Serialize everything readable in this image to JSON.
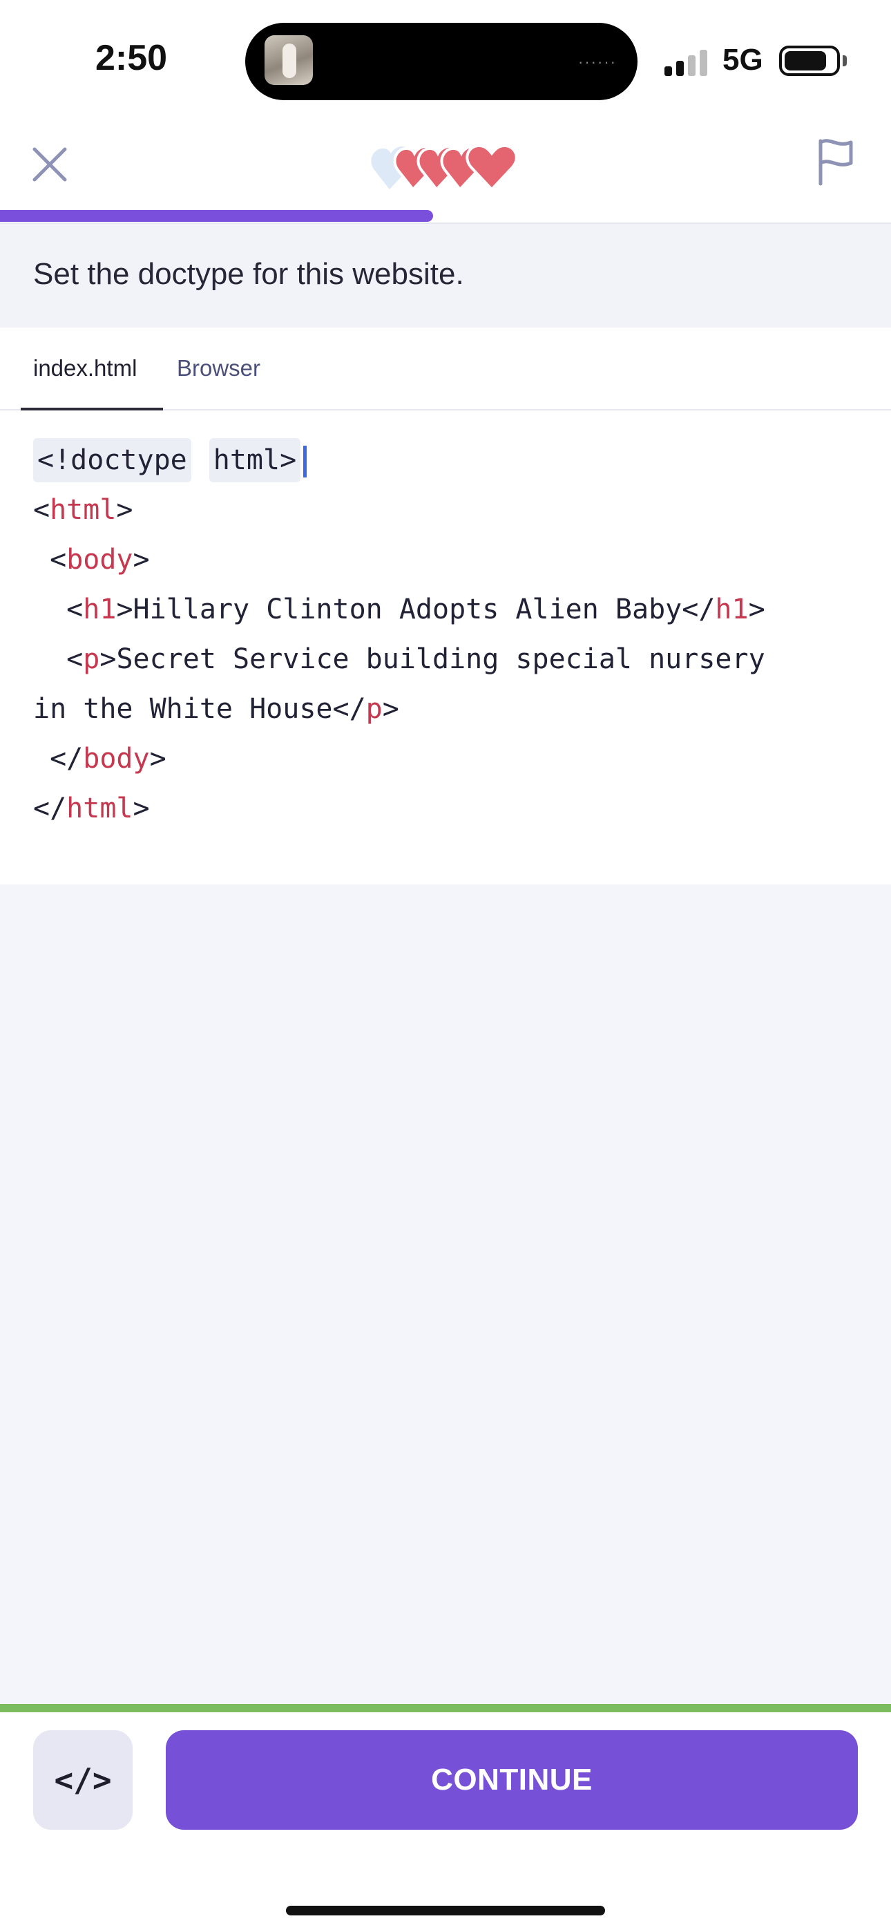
{
  "status_bar": {
    "time": "2:50",
    "network": "5G",
    "dots": "······",
    "signal_bars_active": 2,
    "signal_bars_total": 4
  },
  "header": {
    "close_icon": "close-icon",
    "flag_icon": "flag-icon",
    "hearts": {
      "lost": 1,
      "remaining": 4
    },
    "progress_fraction": 0.54
  },
  "instruction": "Set the doctype for this website.",
  "tabs": [
    {
      "label": "index.html",
      "active": true
    },
    {
      "label": "Browser",
      "active": false
    }
  ],
  "code": {
    "doctype_slot_1": "<!doctype",
    "doctype_slot_2": "html>",
    "lines": [
      "<html>",
      " <body>",
      "  <h1>Hillary Clinton Adopts Alien Baby</h1>",
      "  <p>Secret Service building special nursery",
      "in the White House</p>",
      " </body>",
      "</html>"
    ]
  },
  "footer": {
    "code_toggle_label": "</>",
    "continue_label": "CONTINUE"
  },
  "colors": {
    "accent": "#7650d6",
    "progress": "#7a4fdc",
    "heart": "#e46470",
    "heart_lost": "#dde9f7",
    "tag": "#c5384f",
    "success_bar": "#7dbb5f"
  }
}
